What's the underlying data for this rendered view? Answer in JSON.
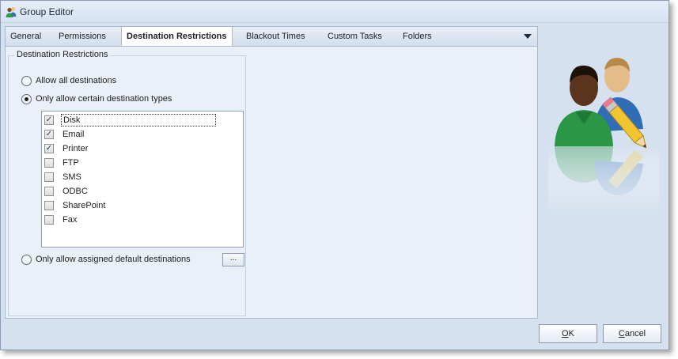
{
  "window": {
    "title": "Group Editor",
    "icon": "group-users-icon"
  },
  "tabs": [
    {
      "label": "General",
      "active": false
    },
    {
      "label": "Permissions",
      "active": false
    },
    {
      "label": "Destination Restrictions",
      "active": true
    },
    {
      "label": "Blackout Times",
      "active": false
    },
    {
      "label": "Custom Tasks",
      "active": false
    },
    {
      "label": "Folders",
      "active": false
    }
  ],
  "tab_overflow_icon": "chevron-down-icon",
  "restrictions": {
    "group_title": "Destination Restrictions",
    "options": [
      {
        "label": "Allow all destinations",
        "selected": false
      },
      {
        "label": "Only allow certain destination types",
        "selected": true
      },
      {
        "label": "Only allow assigned default destinations",
        "selected": false
      }
    ],
    "destination_types": [
      {
        "label": "Disk",
        "checked": true
      },
      {
        "label": "Email",
        "checked": true
      },
      {
        "label": "Printer",
        "checked": true
      },
      {
        "label": "FTP",
        "checked": false
      },
      {
        "label": "SMS",
        "checked": false
      },
      {
        "label": "ODBC",
        "checked": false
      },
      {
        "label": "SharePoint",
        "checked": false
      },
      {
        "label": "Fax",
        "checked": false
      }
    ],
    "ellipsis_label": "..."
  },
  "buttons": {
    "ok": {
      "mnemonic": "O",
      "rest": "K"
    },
    "cancel": {
      "mnemonic": "C",
      "rest": "ancel"
    }
  },
  "illustration": "users-edit-icon",
  "colors": {
    "window_bg": "#d6e1ef",
    "panel_bg": "#eaf0f8",
    "border": "#a9b8cc"
  }
}
